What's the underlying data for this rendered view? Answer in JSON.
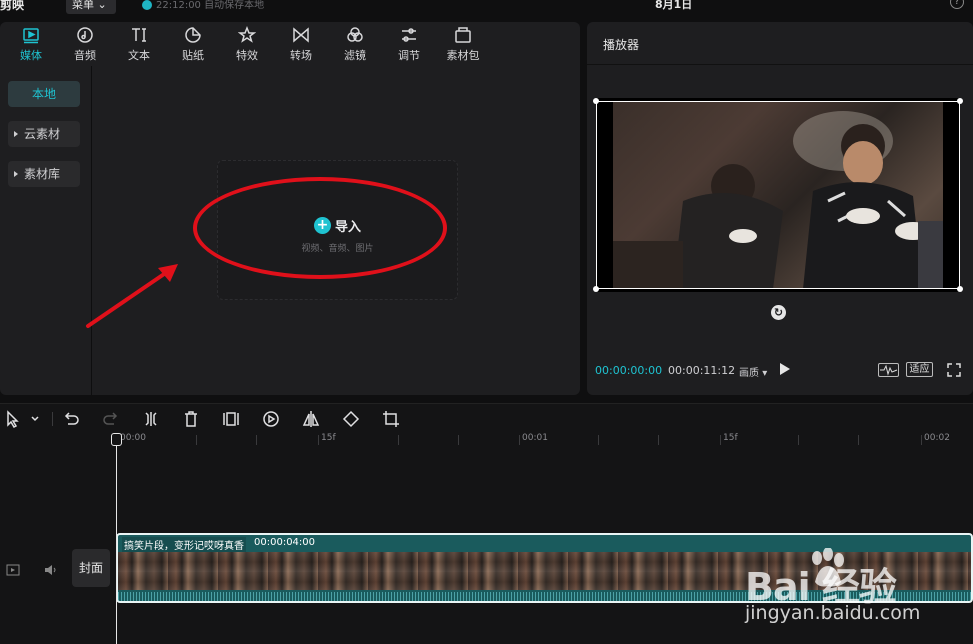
{
  "topbar": {
    "app_title": "剪映",
    "menu_label": "菜单",
    "autosave_text": "22:12:00 自动保存本地",
    "doc_title": "8月1日",
    "help": "?"
  },
  "media_tabs": [
    {
      "label": "媒体",
      "icon": "media-icon",
      "active": true
    },
    {
      "label": "音频",
      "icon": "audio-icon",
      "active": false
    },
    {
      "label": "文本",
      "icon": "text-icon",
      "active": false
    },
    {
      "label": "贴纸",
      "icon": "sticker-icon",
      "active": false
    },
    {
      "label": "特效",
      "icon": "effects-icon",
      "active": false
    },
    {
      "label": "转场",
      "icon": "transition-icon",
      "active": false
    },
    {
      "label": "滤镜",
      "icon": "filter-icon",
      "active": false
    },
    {
      "label": "调节",
      "icon": "adjust-icon",
      "active": false
    },
    {
      "label": "素材包",
      "icon": "package-icon",
      "active": false
    }
  ],
  "media_side": {
    "local": "本地",
    "cloud": "云素材",
    "library": "素材库"
  },
  "import": {
    "label": "导入",
    "subtitle": "视频、音频、图片"
  },
  "player": {
    "title": "播放器",
    "time_current": "00:00:00:00",
    "time_total": "00:00:11:12",
    "quality": "画质",
    "fit": "适应"
  },
  "ruler": [
    "00:00",
    "15f",
    "00:01",
    "15f",
    "00:02"
  ],
  "track": {
    "cover_label": "封面",
    "clip_title": "搞笑片段，变形记哎呀真香",
    "clip_duration": "00:00:04:00"
  },
  "watermark": {
    "logo": "Bai 经验",
    "url": "jingyan.baidu.com"
  },
  "colors": {
    "accent": "#1fc3d1",
    "clip": "#1a5b5d",
    "annotation": "#e0101a"
  }
}
